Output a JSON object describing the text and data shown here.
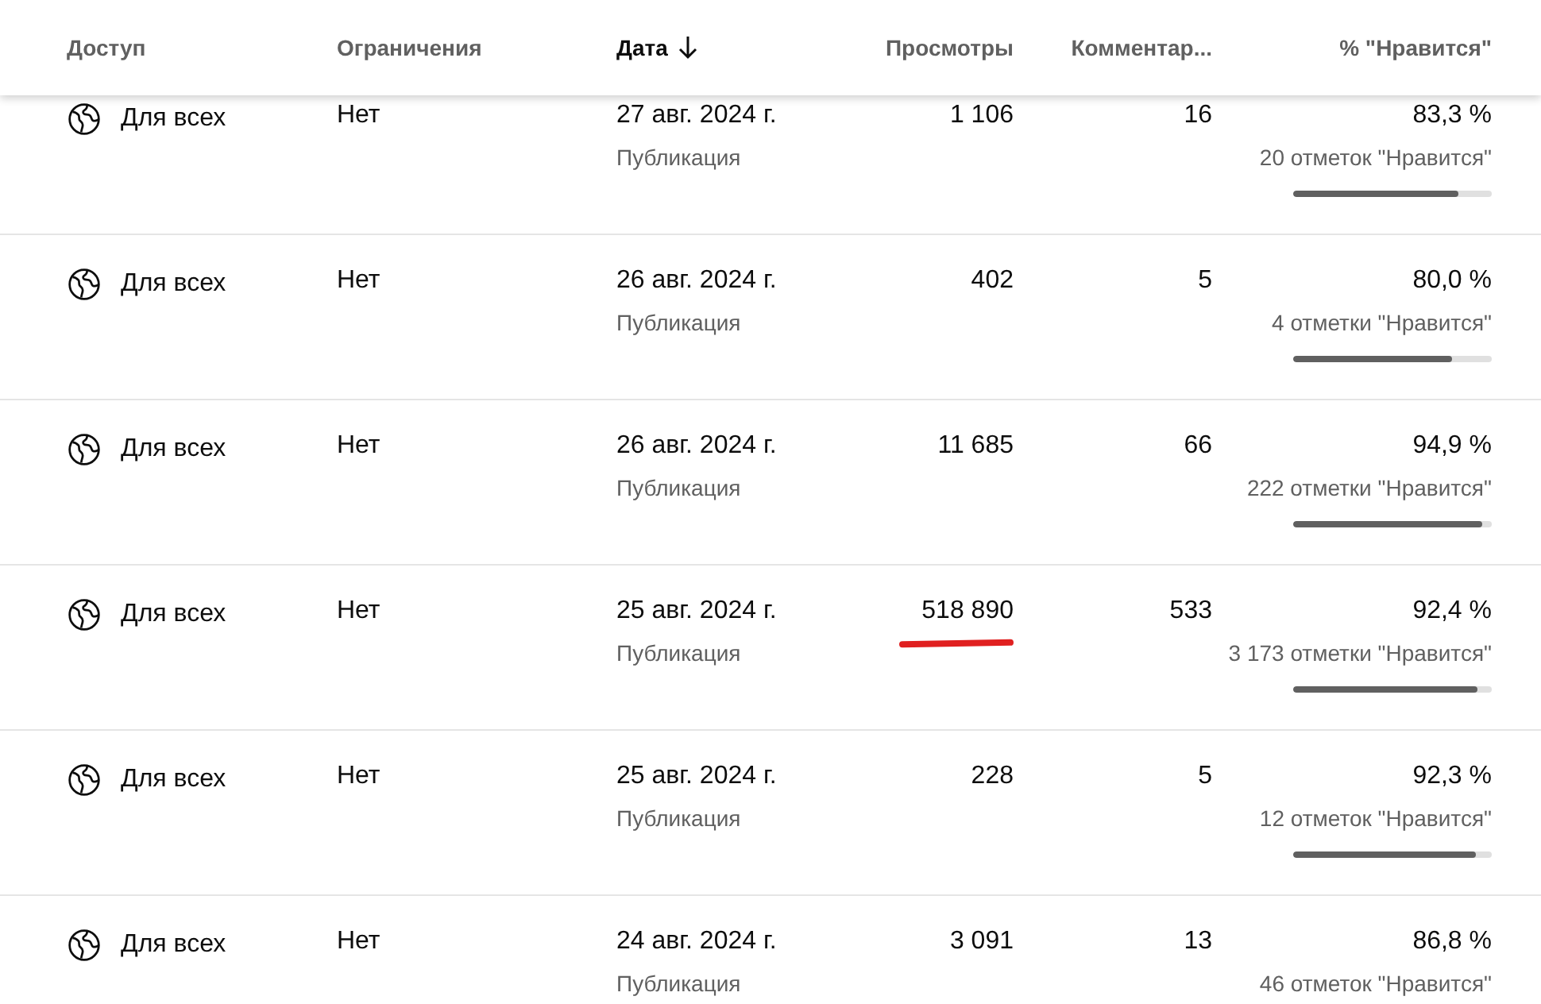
{
  "table": {
    "columns": [
      {
        "label": "Доступ",
        "sorted": false
      },
      {
        "label": "Ограничения",
        "sorted": false
      },
      {
        "label": "Дата",
        "sorted": true
      },
      {
        "label": "Просмотры",
        "sorted": false
      },
      {
        "label": "Комментар...",
        "sorted": false
      },
      {
        "label": "% \"Нравится\"",
        "sorted": false
      }
    ],
    "rows": [
      {
        "access": "Для всех",
        "restrictions": "Нет",
        "date": "27 авг. 2024 г.",
        "date_type": "Публикация",
        "views": "1 106",
        "views_underlined": false,
        "comments": "16",
        "like_percent": "83,3 %",
        "likes": "20 отметок \"Нравится\"",
        "level": 0.833
      },
      {
        "access": "Для всех",
        "restrictions": "Нет",
        "date": "26 авг. 2024 г.",
        "date_type": "Публикация",
        "views": "402",
        "views_underlined": false,
        "comments": "5",
        "like_percent": "80,0 %",
        "likes": "4 отметки \"Нравится\"",
        "level": 0.8
      },
      {
        "access": "Для всех",
        "restrictions": "Нет",
        "date": "26 авг. 2024 г.",
        "date_type": "Публикация",
        "views": "11 685",
        "views_underlined": false,
        "comments": "66",
        "like_percent": "94,9 %",
        "likes": "222 отметки \"Нравится\"",
        "level": 0.949
      },
      {
        "access": "Для всех",
        "restrictions": "Нет",
        "date": "25 авг. 2024 г.",
        "date_type": "Публикация",
        "views": "518 890",
        "views_underlined": true,
        "comments": "533",
        "like_percent": "92,4 %",
        "likes": "3 173 отметки \"Нравится\"",
        "level": 0.924
      },
      {
        "access": "Для всех",
        "restrictions": "Нет",
        "date": "25 авг. 2024 г.",
        "date_type": "Публикация",
        "views": "228",
        "views_underlined": false,
        "comments": "5",
        "like_percent": "92,3 %",
        "likes": "12 отметок \"Нравится\"",
        "level": 0.923
      },
      {
        "access": "Для всех",
        "restrictions": "Нет",
        "date": "24 авг. 2024 г.",
        "date_type": "Публикация",
        "views": "3 091",
        "views_underlined": false,
        "comments": "13",
        "like_percent": "86,8 %",
        "likes": "46 отметок \"Нравится\""
      }
    ]
  }
}
